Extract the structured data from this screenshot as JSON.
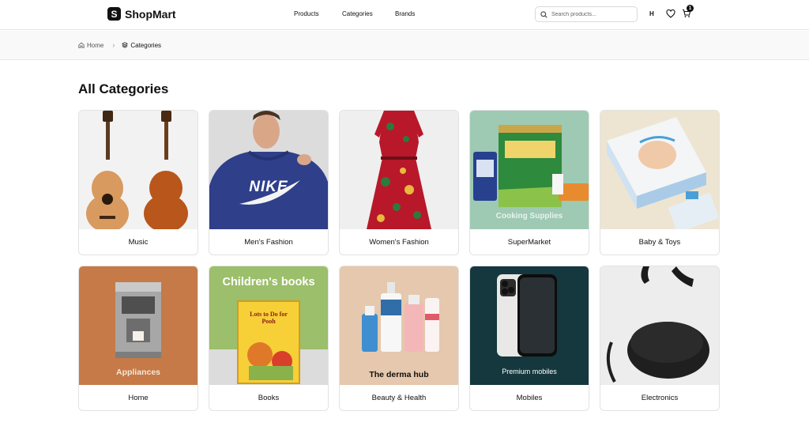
{
  "header": {
    "brand_letter": "S",
    "brand_name": "ShopMart",
    "nav": [
      "Products",
      "Categories",
      "Brands"
    ],
    "search_placeholder": "Search products...",
    "user_initial": "H",
    "cart_count": "1",
    "icons": [
      "search-icon",
      "heart-icon",
      "cart-icon"
    ]
  },
  "breadcrumb": {
    "home": "Home",
    "current": "Categories"
  },
  "page_title": "All Categories",
  "categories": [
    {
      "label": "Music",
      "overlay": ""
    },
    {
      "label": "Men's Fashion",
      "overlay": "NIKE"
    },
    {
      "label": "Women's Fashion",
      "overlay": ""
    },
    {
      "label": "SuperMarket",
      "overlay": "Cooking Supplies"
    },
    {
      "label": "Baby & Toys",
      "overlay": ""
    },
    {
      "label": "Home",
      "overlay": "Appliances"
    },
    {
      "label": "Books",
      "overlay": "Children's books",
      "book_title": "Lots to Do for Pooh"
    },
    {
      "label": "Beauty & Health",
      "overlay": "The derma hub"
    },
    {
      "label": "Mobiles",
      "overlay": "Premium mobiles"
    },
    {
      "label": "Electronics",
      "overlay": ""
    }
  ]
}
